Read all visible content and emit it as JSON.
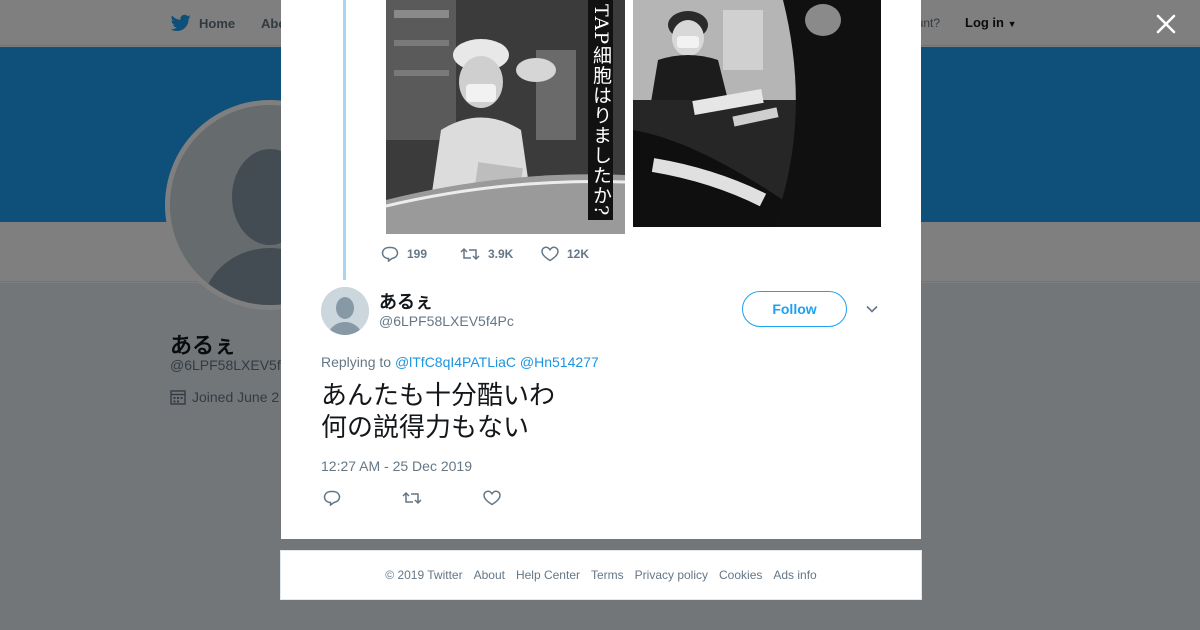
{
  "nav": {
    "home_label": "Home",
    "about_label": "Abo",
    "account_prompt": "ccount?",
    "login_label": "Log in"
  },
  "profile": {
    "name": "あるぇ",
    "handle": "@6LPF58LXEV5f",
    "joined": "Joined June 2"
  },
  "quoted_tweet": {
    "media_overlay_text": "TAP細胞はりましたか?",
    "replies": "199",
    "retweets": "3.9K",
    "likes": "12K"
  },
  "tweet": {
    "author_name": "あるぇ",
    "author_handle": "@6LPF58LXEV5f4Pc",
    "follow_label": "Follow",
    "replying_prefix": "Replying to",
    "mention_1": "@lTfC8qI4PATLiaC",
    "mention_2": "@Hn514277",
    "text": "あんたも十分酷いわ\n何の説得力もない",
    "timestamp": "12:27 AM - 25 Dec 2019"
  },
  "footer": {
    "copyright": "© 2019 Twitter",
    "about": "About",
    "help": "Help Center",
    "terms": "Terms",
    "privacy": "Privacy policy",
    "cookies": "Cookies",
    "ads": "Ads info"
  },
  "colors": {
    "brand_blue": "#1da1f2",
    "link_blue": "#1b95e0",
    "thread_line": "#a9d6f5",
    "muted_text": "#657786"
  },
  "icons": {
    "close": "close-icon",
    "twitter": "twitter-bird-icon",
    "reply": "reply-icon",
    "retweet": "retweet-icon",
    "like": "heart-icon",
    "calendar": "calendar-icon",
    "caret": "chevron-down-icon"
  }
}
